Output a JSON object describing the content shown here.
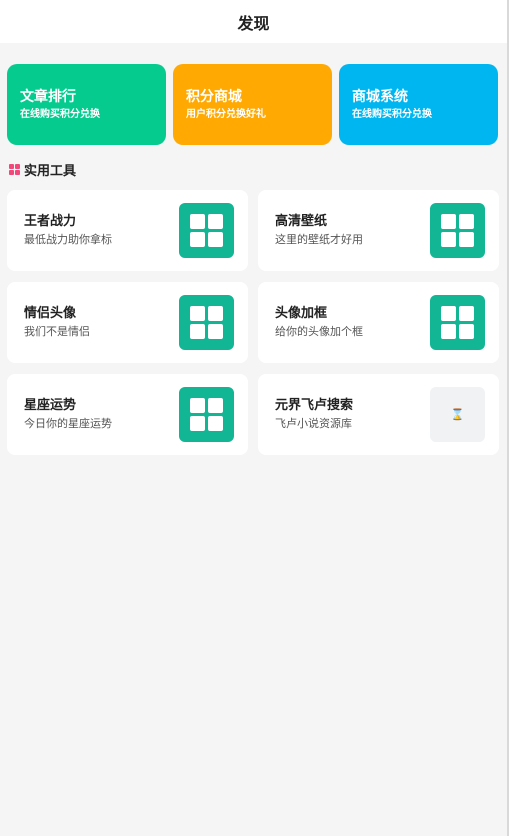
{
  "header": {
    "title": "发现"
  },
  "banners": [
    {
      "title": "文章排行",
      "subtitle": "在线购买积分兑换",
      "color": "#05cb8f"
    },
    {
      "title": "积分商城",
      "subtitle": "用户积分兑换好礼",
      "color": "#ffa902"
    },
    {
      "title": "商城系统",
      "subtitle": "在线购买积分兑换",
      "color": "#00b6f1"
    }
  ],
  "section": {
    "title": "实用工具",
    "icon": "grid-icon",
    "icon_color": "#f0487a"
  },
  "tools": [
    {
      "title": "王者战力",
      "subtitle": "最低战力助你拿标",
      "icon": "grid-icon"
    },
    {
      "title": "高清壁纸",
      "subtitle": "这里的壁纸才好用",
      "icon": "grid-icon"
    },
    {
      "title": "情侣头像",
      "subtitle": "我们不是情侣",
      "icon": "grid-icon"
    },
    {
      "title": "头像加框",
      "subtitle": "给你的头像加个框",
      "icon": "grid-icon"
    },
    {
      "title": "星座运势",
      "subtitle": "今日你的星座运势",
      "icon": "grid-icon"
    },
    {
      "title": "元界飞卢搜索",
      "subtitle": "飞卢小说资源库",
      "icon": "hourglass-icon",
      "icon_glyph": "⌛"
    }
  ],
  "colors": {
    "tool_icon_bg": "#12b594",
    "page_bg": "#f5f5f5"
  }
}
